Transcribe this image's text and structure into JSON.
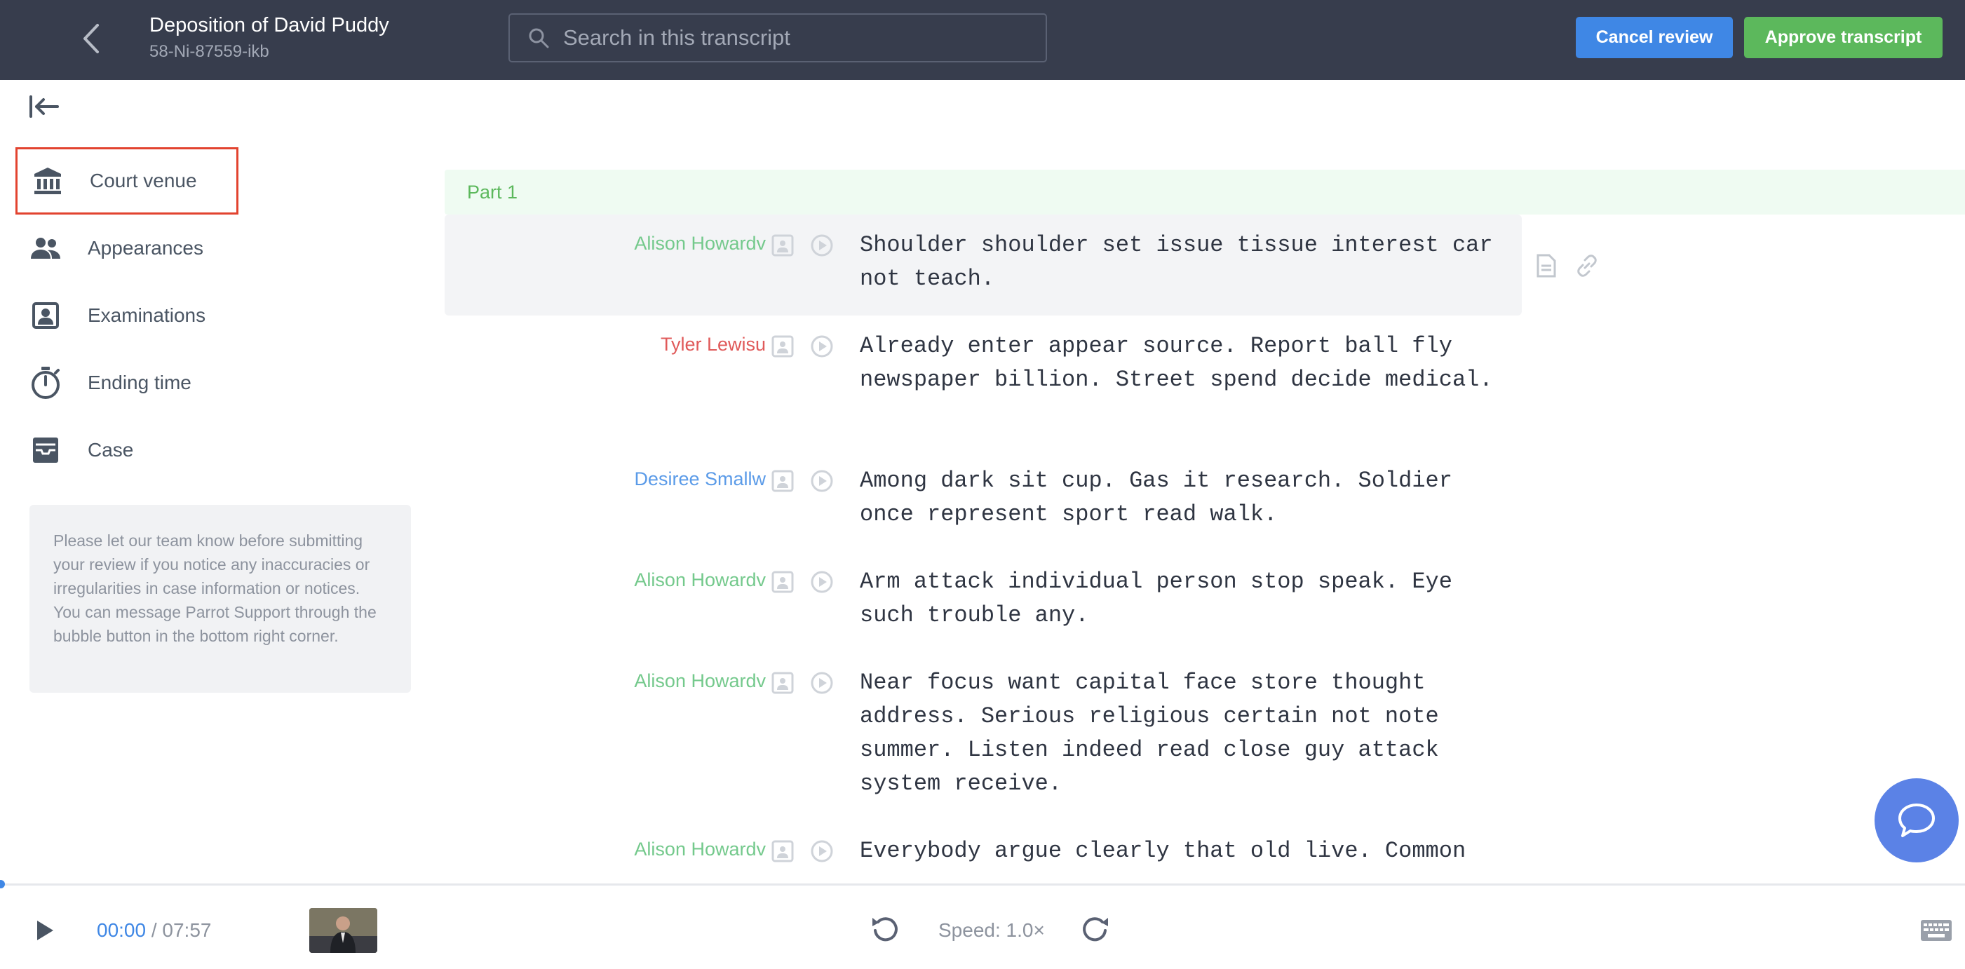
{
  "header": {
    "title": "Deposition of David Puddy",
    "subtitle": "58-Ni-87559-ikb",
    "search_placeholder": "Search in this transcript",
    "cancel_label": "Cancel review",
    "approve_label": "Approve transcript"
  },
  "sidebar": {
    "items": [
      {
        "label": "Court venue",
        "icon": "bank-icon",
        "active": true
      },
      {
        "label": "Appearances",
        "icon": "people-icon"
      },
      {
        "label": "Examinations",
        "icon": "portrait-icon"
      },
      {
        "label": "Ending time",
        "icon": "stopwatch-icon"
      },
      {
        "label": "Case",
        "icon": "inbox-icon"
      }
    ],
    "notice": "Please let our team know before submitting your review if you notice any inaccuracies or irregularities in case information or notices. You can message Parrot Support through the bubble button in the bottom right corner."
  },
  "transcript": {
    "part_label": "Part 1",
    "rows": [
      {
        "speaker": "Alison Howardv",
        "text": "Shoulder shoulder set issue tissue interest car not teach."
      },
      {
        "speaker": "Tyler Lewisu",
        "text": "Already enter appear source. Report ball fly newspaper billion. Street spend decide medical."
      },
      {
        "speaker": "Desiree Smallw",
        "text": "Among dark sit cup. Gas it research. Soldier once represent sport read walk."
      },
      {
        "speaker": "Alison Howardv",
        "text": "Arm attack individual person stop speak. Eye such trouble any."
      },
      {
        "speaker": "Alison Howardv",
        "text": "Near focus want capital face store thought address. Serious religious certain not note summer. Listen indeed read close guy attack system receive."
      },
      {
        "speaker": "Alison Howardv",
        "text": "Everybody argue clearly that old live. Common"
      }
    ]
  },
  "player": {
    "current_time": "00:00",
    "total_time": " / 07:57",
    "speed_label": "Speed: 1.0×"
  },
  "colors": {
    "header_bg": "#373d4d",
    "accent_blue": "#3f87e5",
    "accent_green": "#5cb85c",
    "active_outline": "#e2432f"
  }
}
